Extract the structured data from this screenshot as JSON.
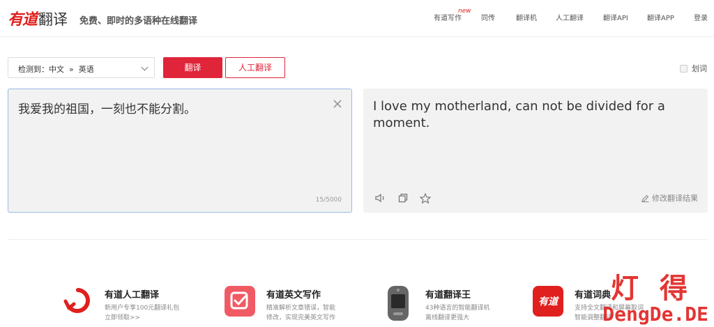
{
  "header": {
    "logo_youdao": "有道",
    "logo_fanyi": "翻译",
    "slogan": "免费、即时的多语种在线翻译",
    "nav": [
      {
        "label": "有道写作",
        "badge": "new"
      },
      {
        "label": "同传"
      },
      {
        "label": "翻译机"
      },
      {
        "label": "人工翻译"
      },
      {
        "label": "翻译API"
      },
      {
        "label": "翻译APP"
      },
      {
        "label": "登录"
      }
    ]
  },
  "controls": {
    "lang_select": "检测到：中文  »  英语",
    "translate_btn": "翻译",
    "human_btn": "人工翻译",
    "word_pick": "划词"
  },
  "source": {
    "text": "我爱我的祖国，一刻也不能分割。",
    "count": "15/5000"
  },
  "target": {
    "text": "I love my motherland, can not be divided for a moment.",
    "edit_label": "修改翻译结果"
  },
  "products": [
    {
      "title": "有道人工翻译",
      "desc1": "新用户专享100元翻译礼包",
      "desc2": "立即领取>>",
      "color": "#e0201e",
      "icon": "human-translate-icon"
    },
    {
      "title": "有道英文写作",
      "desc1": "精准解析文章错误，智能",
      "desc2": "修改，实现完美英文写作",
      "color": "#f05a64",
      "icon": "writing-check-icon"
    },
    {
      "title": "有道翻译王",
      "desc1": "43种语言的智能翻译机",
      "desc2": "离线翻译更强大",
      "color": "#555555",
      "icon": "translator-device-icon"
    },
    {
      "title": "有道词典",
      "desc1": "支持全文翻译和屏幕取词",
      "desc2": "智能调整翻译",
      "color": "#e0201e",
      "icon": "dictionary-app-icon",
      "icon_text": "有道"
    }
  ],
  "watermark": {
    "chars": "灯得",
    "url": "DengDe.DE"
  },
  "colors": {
    "accent": "#e0243a",
    "brand": "#e0201e",
    "panel_bg": "#f2f2f2",
    "focus_border": "#9ab8e8"
  }
}
